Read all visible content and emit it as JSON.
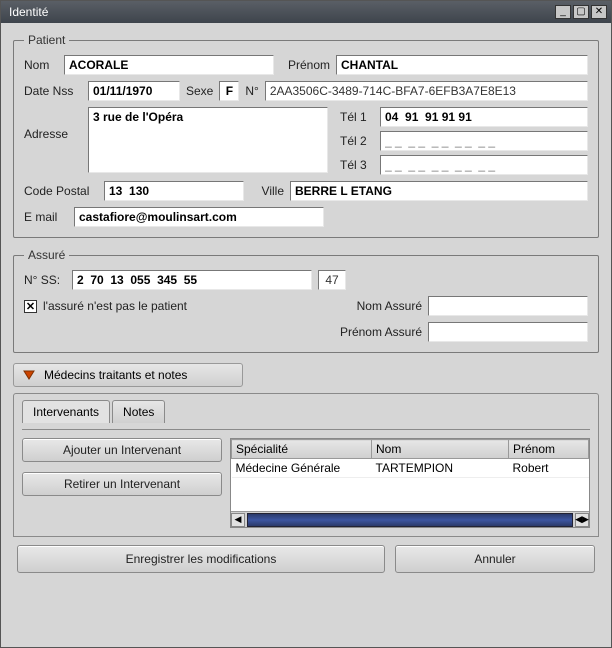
{
  "window": {
    "title": "Identité"
  },
  "patient": {
    "legend": "Patient",
    "nom_label": "Nom",
    "nom": "ACORALE",
    "prenom_label": "Prénom",
    "prenom": "CHANTAL",
    "date_nss_label": "Date Nss",
    "date_nss": "01/11/1970",
    "sexe_label": "Sexe",
    "sexe": "F",
    "num_label": "N°",
    "num": "2AA3506C-3489-714C-BFA7-6EFB3A7E8E13",
    "adresse_label": "Adresse",
    "adresse": "3 rue de l'Opéra",
    "tel1_label": "Tél 1",
    "tel1": "04  91  91 91 91",
    "tel2_label": "Tél 2",
    "tel2_placeholder": "_ _  _ _  _ _  _ _  _ _",
    "tel3_label": "Tél 3",
    "tel3_placeholder": "_ _  _ _  _ _  _ _  _ _",
    "cp_label": "Code Postal",
    "cp": "13  130",
    "ville_label": "Ville",
    "ville": "BERRE L ETANG",
    "email_label": "E mail",
    "email": "castafiore@moulinsart.com"
  },
  "assure": {
    "legend": "Assuré",
    "nss_label": "N° SS:",
    "nss": "2  70  13  055  345  55",
    "nss_key": "47",
    "not_patient_checked": true,
    "not_patient_label": "l'assuré n'est pas le patient",
    "nom_assure_label": "Nom Assuré",
    "nom_assure": "",
    "prenom_assure_label": "Prénom Assuré",
    "prenom_assure": ""
  },
  "notes_section": {
    "label": "Médecins traitants et notes"
  },
  "tabs": {
    "intervenants": "Intervenants",
    "notes": "Notes",
    "add_btn": "Ajouter un Intervenant",
    "remove_btn": "Retirer un Intervenant",
    "columns": {
      "spec": "Spécialité",
      "nom": "Nom",
      "prenom": "Prénom"
    },
    "rows": [
      {
        "spec": "Médecine Générale",
        "nom": "TARTEMPION",
        "prenom": "Robert"
      }
    ]
  },
  "footer": {
    "save": "Enregistrer les modifications",
    "cancel": "Annuler"
  }
}
